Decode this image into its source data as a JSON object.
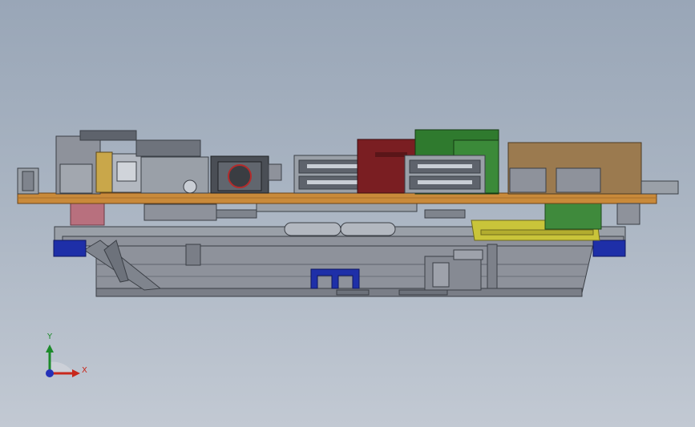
{
  "viewport": {
    "background_top": "#99a6b7",
    "background_bottom": "#c2c9d3"
  },
  "model": {
    "colors": {
      "pcb": "#c98a3a",
      "chassis": "#8e929b",
      "chassis_dark": "#5e636c",
      "connector_grey": "#9aa0a8",
      "red_module": "#7a1e22",
      "green_module": "#2f7a2e",
      "tan_module": "#9b7a4f",
      "yellow_bracket": "#c9c43a",
      "blue_clip": "#1e2fa8",
      "pink_spacer": "#b8707e"
    }
  },
  "triad": {
    "x_label": "X",
    "y_label": "Y",
    "x_color": "#c8281c",
    "y_color": "#1c8a2a",
    "z_color": "#2431b8"
  }
}
